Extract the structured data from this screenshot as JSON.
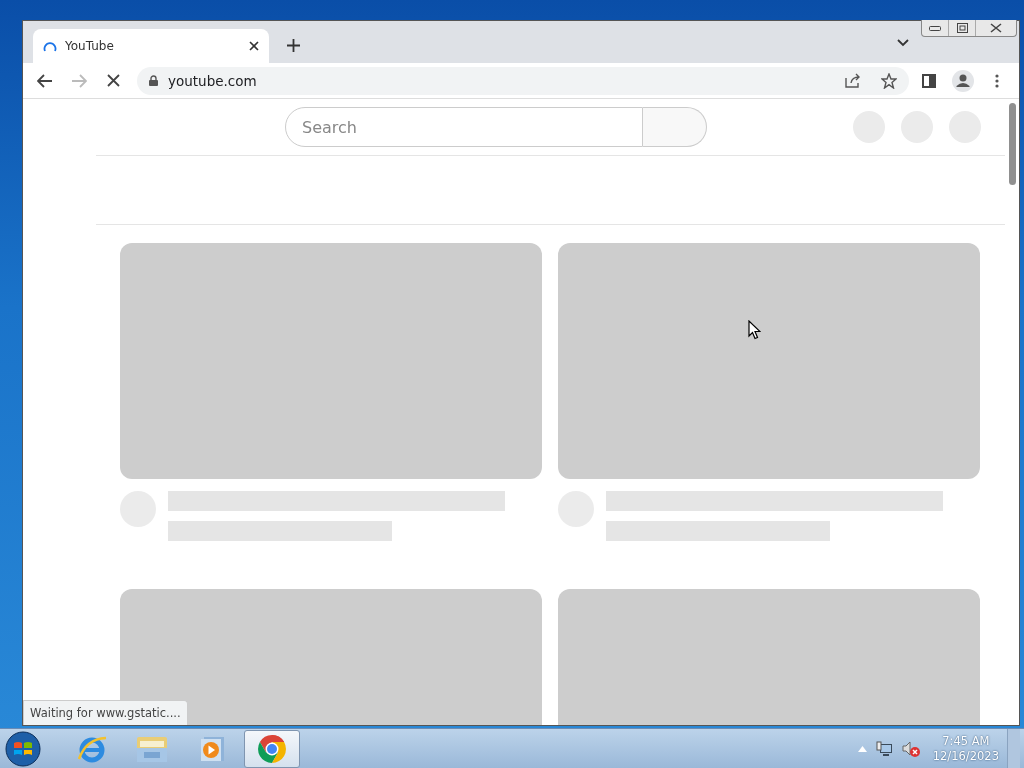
{
  "browser": {
    "tabs": [
      {
        "title": "YouTube",
        "selected": true,
        "loading": true
      }
    ],
    "address": "youtube.com",
    "page_loading": true
  },
  "page": {
    "search": {
      "placeholder": "Search"
    }
  },
  "status_bubble": "Waiting for www.gstatic....",
  "taskbar": {
    "apps": [
      {
        "kind": "ie",
        "selected": false
      },
      {
        "kind": "explorer",
        "selected": false
      },
      {
        "kind": "media",
        "selected": false
      },
      {
        "kind": "chrome",
        "selected": true
      }
    ],
    "clock": {
      "time": "7:45 AM",
      "date": "12/16/2023"
    }
  }
}
